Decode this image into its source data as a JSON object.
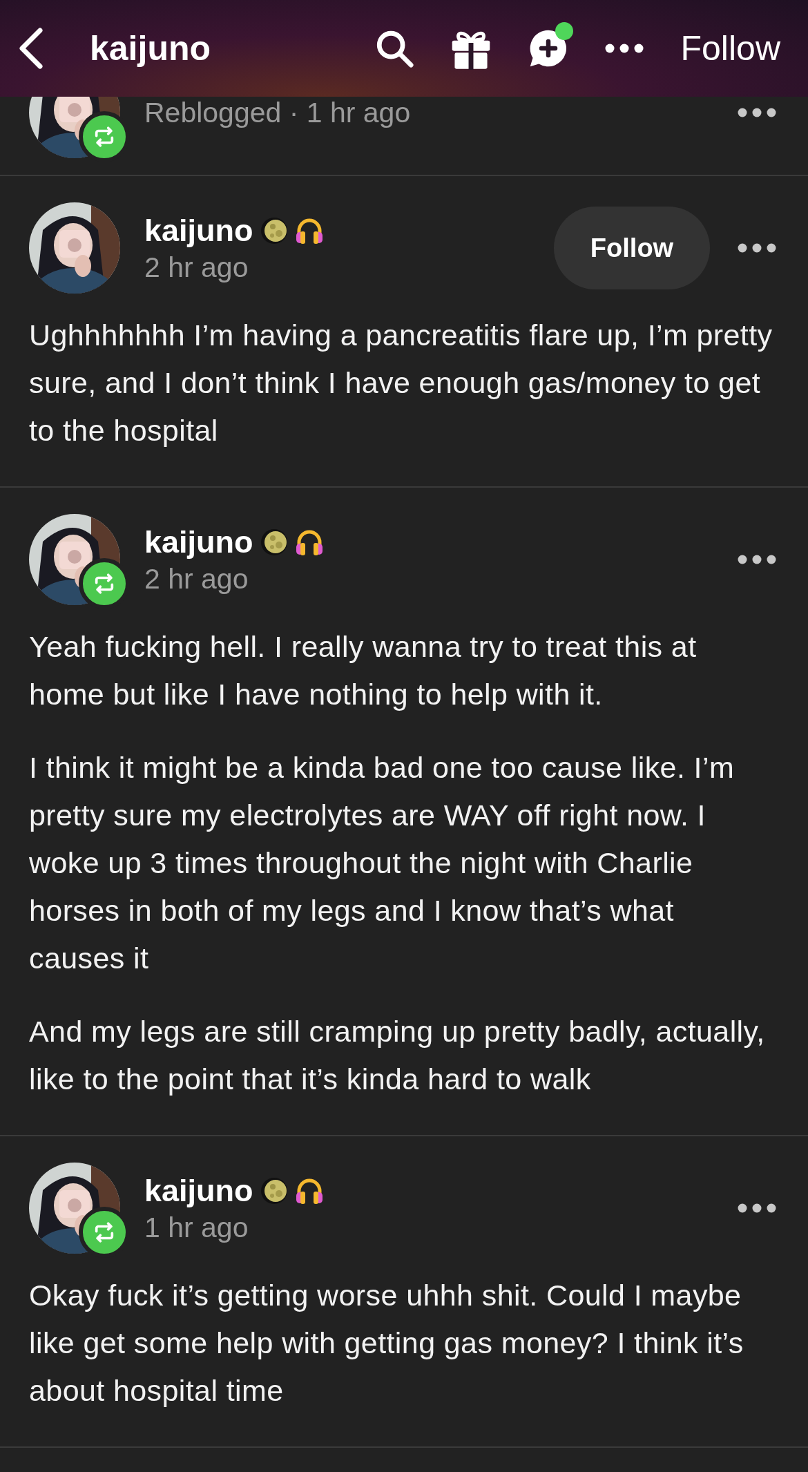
{
  "header": {
    "title": "kaijuno",
    "notification_dot": true,
    "follow_label": "Follow"
  },
  "posts": [
    {
      "kind": "partial",
      "reblogged": true,
      "meta": "Reblogged · 1 hr ago"
    },
    {
      "kind": "full",
      "reblogged": false,
      "name": "kaijuno",
      "time": "2 hr ago",
      "follow_label": "Follow",
      "paragraphs": [
        "Ughhhhhhh I’m having a pancreatitis flare up, I’m pretty sure, and I don’t think I have enough gas/money to get to the hospital"
      ]
    },
    {
      "kind": "full",
      "reblogged": true,
      "name": "kaijuno",
      "time": "2 hr ago",
      "paragraphs": [
        "Yeah fucking hell. I really wanna try to treat this at home but like I have nothing to help with it.",
        "I think it might be a kinda bad one too cause like. I’m pretty sure my electrolytes are WAY off right now. I woke up 3 times throughout the night with Charlie horses in both of my legs and I know that’s what causes it",
        "And my legs are still cramping up pretty badly, actually, like to the point that it’s kinda hard to walk"
      ]
    },
    {
      "kind": "full",
      "reblogged": true,
      "name": "kaijuno",
      "time": "1 hr ago",
      "paragraphs": [
        "Okay fuck it’s getting worse uhhh shit. Could I maybe like get some help with getting gas money? I think it’s about hospital time"
      ]
    }
  ]
}
